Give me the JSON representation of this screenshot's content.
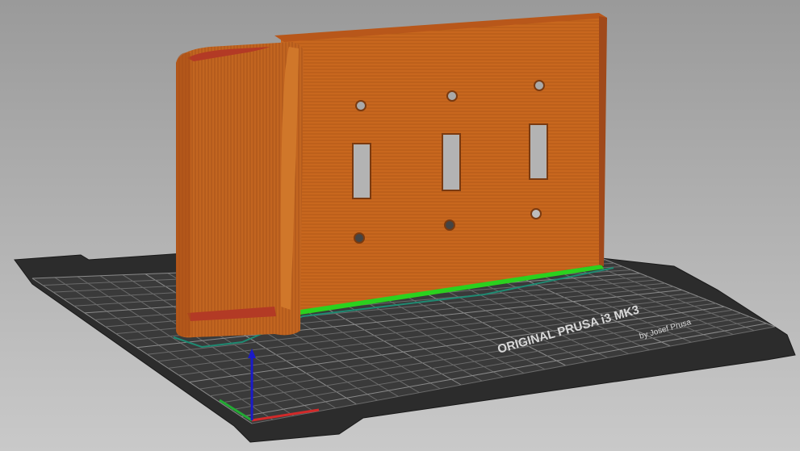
{
  "viewer": {
    "bed": {
      "brand_line": "ORIGINAL PRUSA i3  MK3",
      "maker_line": "by Josef Prusa",
      "colors": {
        "background_top": "#9a9a9a",
        "background_bottom": "#c9c9c9",
        "bed": "#2a2a2a",
        "grid": "#6a6a6a",
        "text": "#d8d8d8"
      }
    },
    "model": {
      "name_icon": "toggle-switch-plate-preview",
      "colors": {
        "perimeter": "#c8671e",
        "perimeter_dark": "#a8521a",
        "interior_red": "#b33a25",
        "first_layer": "#2bd11e",
        "skirt": "#1f8a72"
      }
    },
    "axes": {
      "x_color": "#d22a2a",
      "y_color": "#22aa33",
      "z_color": "#1a1ac8"
    }
  }
}
